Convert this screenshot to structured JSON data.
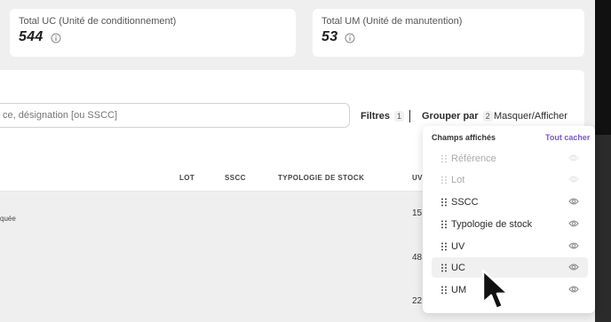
{
  "stats": {
    "uc": {
      "label": "Total UC (Unité de conditionnement)",
      "value": "544"
    },
    "um": {
      "label": "Total UM (Unité de manutention)",
      "value": "53"
    }
  },
  "search": {
    "placeholder": "ce, désignation [ou SSCC]"
  },
  "toolbar": {
    "filters_label": "Filtres",
    "filters_count": "1",
    "group_label": "Grouper par",
    "group_count": "2",
    "show_hide_label": "Masquer/Afficher"
  },
  "table": {
    "headers": {
      "lot": "LOT",
      "sscc": "SSCC",
      "typology": "TYPOLOGIE DE STOCK",
      "uv": "UV"
    },
    "rows": [
      {
        "partial_text": "quée",
        "uv": "15"
      },
      {
        "partial_text": "",
        "uv": "48"
      },
      {
        "partial_text": "",
        "uv": "22"
      }
    ]
  },
  "dropdown": {
    "title": "Champs affichés",
    "action": "Tout cacher",
    "items": [
      {
        "label": "Référence",
        "disabled": true
      },
      {
        "label": "Lot",
        "disabled": true
      },
      {
        "label": "SSCC",
        "disabled": false
      },
      {
        "label": "Typologie de stock",
        "disabled": false
      },
      {
        "label": "UV",
        "disabled": false
      },
      {
        "label": "UC",
        "disabled": false,
        "highlighted": true
      },
      {
        "label": "UM",
        "disabled": false
      }
    ]
  },
  "colors": {
    "accent": "#7b55d6",
    "panel": "#ffffff",
    "background": "#efefef"
  }
}
